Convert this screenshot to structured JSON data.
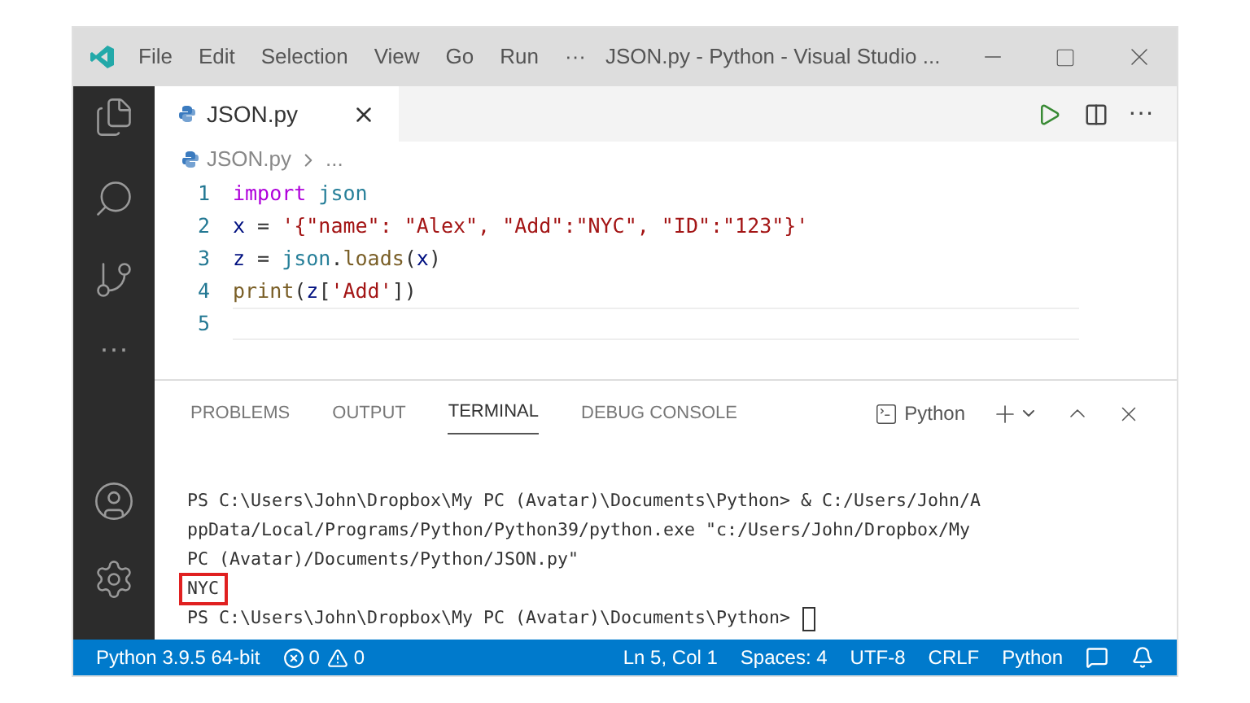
{
  "title_bar": {
    "menu": [
      "File",
      "Edit",
      "Selection",
      "View",
      "Go",
      "Run"
    ],
    "overflow": "···",
    "title": "JSON.py - Python - Visual Studio ..."
  },
  "editor": {
    "tabs": [
      {
        "label": "JSON.py",
        "selected": true
      }
    ],
    "actions_more": "···",
    "breadcrumb": {
      "file": "JSON.py",
      "rest": "..."
    },
    "lines": [
      {
        "number": "1",
        "current": false,
        "tokens": [
          {
            "text": "import",
            "kind": "keyword"
          },
          {
            "text": " json",
            "kind": "module"
          }
        ]
      },
      {
        "number": "2",
        "current": false,
        "tokens": [
          {
            "text": "x",
            "kind": "var"
          },
          {
            "text": " = ",
            "kind": "plain"
          },
          {
            "text": "'{\"name\": \"Alex\", \"Add\":\"NYC\", \"ID\":\"123\"}'",
            "kind": "string"
          }
        ]
      },
      {
        "number": "3",
        "current": false,
        "tokens": [
          {
            "text": "z",
            "kind": "var"
          },
          {
            "text": " = ",
            "kind": "plain"
          },
          {
            "text": "json",
            "kind": "module"
          },
          {
            "text": ".",
            "kind": "plain"
          },
          {
            "text": "loads",
            "kind": "func"
          },
          {
            "text": "(",
            "kind": "plain"
          },
          {
            "text": "x",
            "kind": "var"
          },
          {
            "text": ")",
            "kind": "plain"
          }
        ]
      },
      {
        "number": "4",
        "current": false,
        "tokens": [
          {
            "text": "print",
            "kind": "func"
          },
          {
            "text": "(",
            "kind": "plain"
          },
          {
            "text": "z",
            "kind": "var"
          },
          {
            "text": "[",
            "kind": "plain"
          },
          {
            "text": "'Add'",
            "kind": "string"
          },
          {
            "text": "])",
            "kind": "plain"
          }
        ]
      },
      {
        "number": "5",
        "current": true
      }
    ]
  },
  "ellipsis": "···",
  "panel": {
    "tabs": [
      {
        "label": "PROBLEMS",
        "selected": false
      },
      {
        "label": "OUTPUT",
        "selected": false
      },
      {
        "label": "TERMINAL",
        "selected": true
      },
      {
        "label": "DEBUG CONSOLE",
        "selected": false
      }
    ],
    "shell": "Python",
    "terminal": [
      {
        "text": "PS C:\\Users\\John\\Dropbox\\My PC (Avatar)\\Documents\\Python> & C:/Users/John/A",
        "highlighted": false,
        "cursor": false
      },
      {
        "text": "ppData/Local/Programs/Python/Python39/python.exe \"c:/Users/John/Dropbox/My",
        "highlighted": false,
        "cursor": false
      },
      {
        "text": "PC (Avatar)/Documents/Python/JSON.py\"",
        "highlighted": false,
        "cursor": false
      },
      {
        "text": "NYC",
        "highlighted": true,
        "cursor": false
      },
      {
        "text": "PS C:\\Users\\John\\Dropbox\\My PC (Avatar)\\Documents\\Python>",
        "highlighted": false,
        "cursor": true
      }
    ]
  },
  "status_bar": {
    "interpreter": "Python 3.9.5 64-bit",
    "errors": "0",
    "warnings": "0",
    "position": "Ln 5, Col 1",
    "spaces": "Spaces: 4",
    "encoding": "UTF-8",
    "eol": "CRLF",
    "language": "Python"
  }
}
